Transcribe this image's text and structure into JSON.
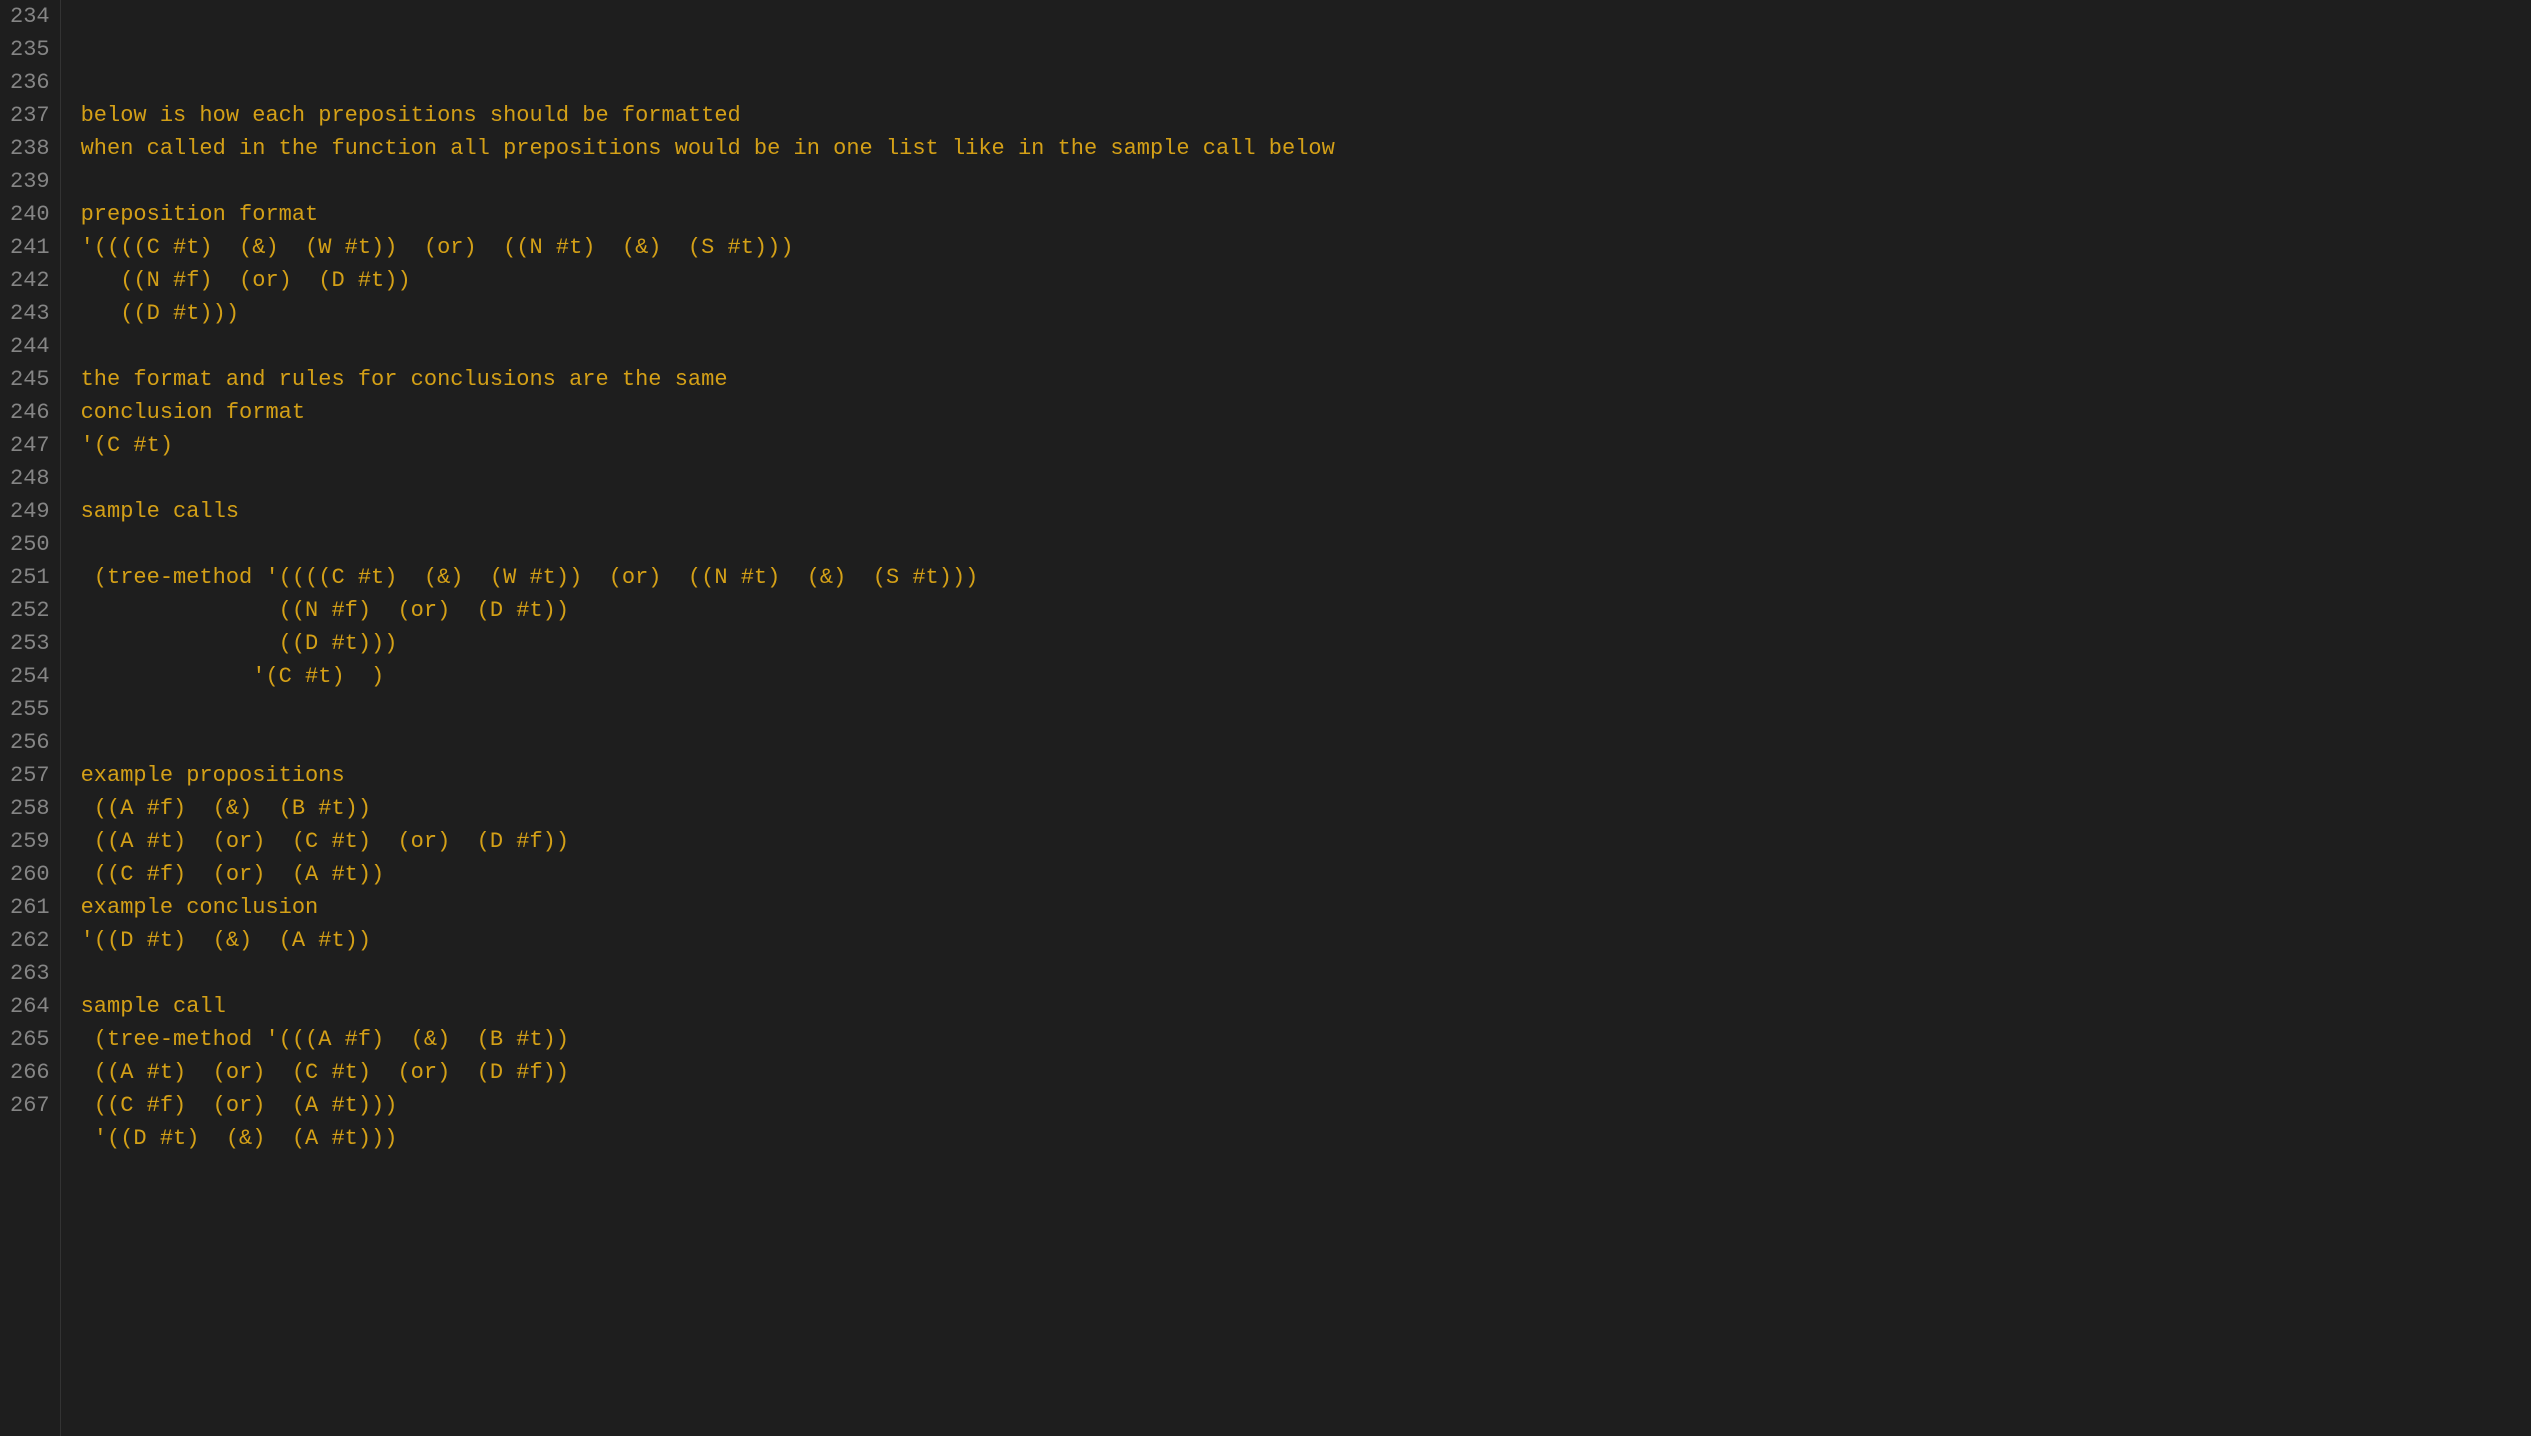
{
  "editor": {
    "background": "#1e1e1e",
    "text_color": "#d4a017",
    "line_number_color": "#858585",
    "font": "Courier New",
    "lines": [
      {
        "num": 234,
        "text": ""
      },
      {
        "num": 235,
        "text": "below is how each prepositions should be formatted"
      },
      {
        "num": 236,
        "text": "when called in the function all prepositions would be in one list like in the sample call below"
      },
      {
        "num": 237,
        "text": ""
      },
      {
        "num": 238,
        "text": "preposition format"
      },
      {
        "num": 239,
        "text": "'((((C #t)  (&)  (W #t))  (or)  ((N #t)  (&)  (S #t)))"
      },
      {
        "num": 240,
        "text": "   ((N #f)  (or)  (D #t))"
      },
      {
        "num": 241,
        "text": "   ((D #t)))"
      },
      {
        "num": 242,
        "text": ""
      },
      {
        "num": 243,
        "text": "the format and rules for conclusions are the same"
      },
      {
        "num": 244,
        "text": "conclusion format"
      },
      {
        "num": 245,
        "text": "'(C #t)"
      },
      {
        "num": 246,
        "text": ""
      },
      {
        "num": 247,
        "text": "sample calls"
      },
      {
        "num": 248,
        "text": ""
      },
      {
        "num": 249,
        "text": " (tree-method '((((C #t)  (&)  (W #t))  (or)  ((N #t)  (&)  (S #t)))"
      },
      {
        "num": 250,
        "text": "               ((N #f)  (or)  (D #t))"
      },
      {
        "num": 251,
        "text": "               ((D #t)))"
      },
      {
        "num": 252,
        "text": "             '(C #t)  )"
      },
      {
        "num": 253,
        "text": ""
      },
      {
        "num": 254,
        "text": ""
      },
      {
        "num": 255,
        "text": "example propositions"
      },
      {
        "num": 256,
        "text": " ((A #f)  (&)  (B #t))"
      },
      {
        "num": 257,
        "text": " ((A #t)  (or)  (C #t)  (or)  (D #f))"
      },
      {
        "num": 258,
        "text": " ((C #f)  (or)  (A #t))"
      },
      {
        "num": 259,
        "text": "example conclusion"
      },
      {
        "num": 260,
        "text": "'((D #t)  (&)  (A #t))"
      },
      {
        "num": 261,
        "text": ""
      },
      {
        "num": 262,
        "text": "sample call"
      },
      {
        "num": 263,
        "text": " (tree-method '(((A #f)  (&)  (B #t))"
      },
      {
        "num": 264,
        "text": " ((A #t)  (or)  (C #t)  (or)  (D #f))"
      },
      {
        "num": 265,
        "text": " ((C #f)  (or)  (A #t)))"
      },
      {
        "num": 266,
        "text": " '((D #t)  (&)  (A #t)))"
      },
      {
        "num": 267,
        "text": ""
      }
    ]
  }
}
